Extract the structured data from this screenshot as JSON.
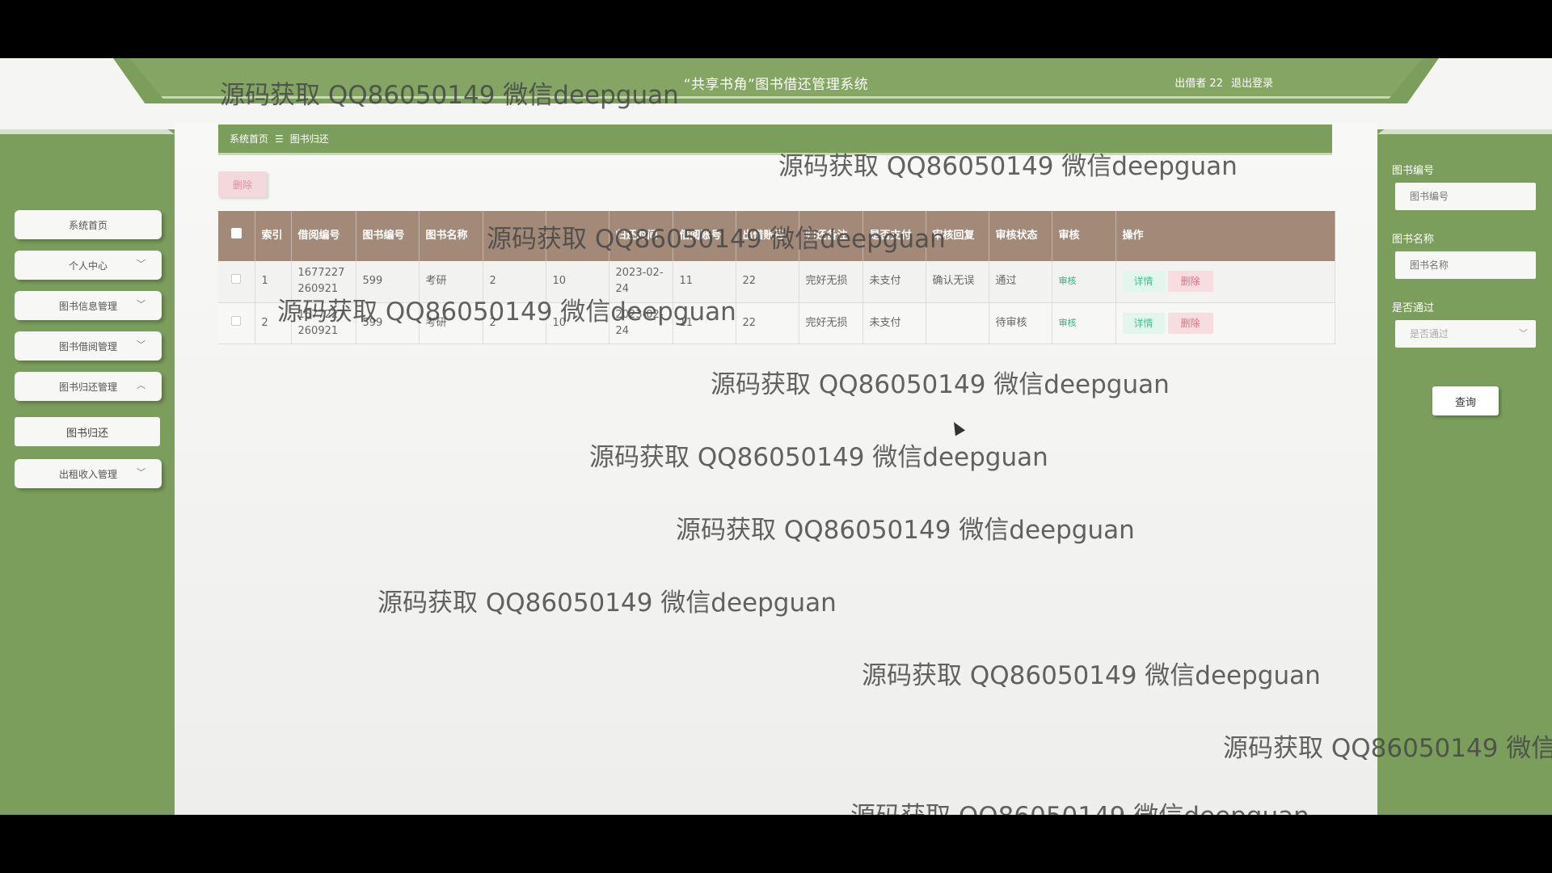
{
  "header": {
    "title": "“共享书角”图书借还管理系统",
    "user_label": "出借者 22",
    "logout_label": "退出登录"
  },
  "sidebar": {
    "items": [
      {
        "label": "系统首页",
        "has_chevron": false
      },
      {
        "label": "个人中心",
        "has_chevron": true,
        "chevron": "chevron-down-icon"
      },
      {
        "label": "图书信息管理",
        "has_chevron": true,
        "chevron": "chevron-down-icon"
      },
      {
        "label": "图书借阅管理",
        "has_chevron": true,
        "chevron": "chevron-down-icon"
      },
      {
        "label": "图书归还管理",
        "has_chevron": true,
        "chevron": "chevron-up-icon"
      },
      {
        "label": "图书归还",
        "has_chevron": false
      },
      {
        "label": "出租收入管理",
        "has_chevron": true,
        "chevron": "chevron-down-icon"
      }
    ]
  },
  "breadcrumb": {
    "home": "系统首页",
    "separator": "☰",
    "current": "图书归还"
  },
  "toolbar": {
    "delete_label": "删除"
  },
  "table": {
    "headers": [
      "",
      "索引",
      "借阅编号",
      "图书编号",
      "图书名称",
      "",
      "",
      "归还时间",
      "借阅账号",
      "出借账号",
      "归还备注",
      "是否支付",
      "审核回复",
      "审核状态",
      "审核",
      "操作"
    ],
    "rows": [
      {
        "index": "1",
        "borrow_no": "1677227260921",
        "book_no": "599",
        "book_name": "考研",
        "c5": "2",
        "c6": "10",
        "return_time": "2023-02-24",
        "borrow_account": "11",
        "lender_account": "22",
        "remark": "完好无损",
        "paid": "未支付",
        "reply": "确认无误",
        "status": "通过",
        "audit": "审核",
        "detail": "详情",
        "delete": "删除"
      },
      {
        "index": "2",
        "borrow_no": "1677227260921",
        "book_no": "599",
        "book_name": "考研",
        "c5": "2",
        "c6": "10",
        "return_time": "2023-02-24",
        "borrow_account": "11",
        "lender_account": "22",
        "remark": "完好无损",
        "paid": "未支付",
        "reply": "",
        "status": "待审核",
        "audit": "审核",
        "detail": "详情",
        "delete": "删除"
      }
    ]
  },
  "search": {
    "book_no_label": "图书编号",
    "book_no_placeholder": "图书编号",
    "book_name_label": "图书名称",
    "book_name_placeholder": "图书名称",
    "passed_label": "是否通过",
    "passed_placeholder": "是否通过",
    "query_label": "查询"
  },
  "watermark": {
    "text": "源码获取 QQ86050149 微信deepguan"
  },
  "colors": {
    "theme_green": "#7b9e5c",
    "table_header": "#a38978",
    "detail_green": "#44c48e",
    "delete_red": "#e0707f"
  }
}
